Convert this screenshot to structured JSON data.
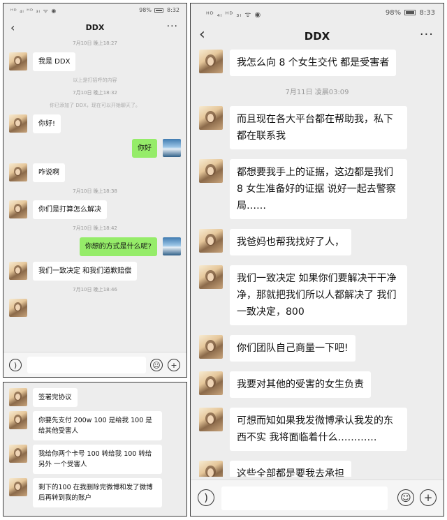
{
  "status": {
    "left": "ᴴᴰ ₄ₗ ᴴᴰ ₃ₗ ᯤ ◉",
    "battery_left": "98%",
    "time_left": "8:32",
    "battery_right": "98%",
    "time_right": "8:33"
  },
  "chat": {
    "title": "DDX",
    "back_icon": "‹",
    "more_icon": "···"
  },
  "panel_a": {
    "time_1": "7月10日 晚上18:27",
    "msg_1": "我是 DDX",
    "sys_1": "以上是打招呼的内容",
    "time_2": "7月10日 晚上18:32",
    "sys_2": "你已添加了 DDX，现在可以开始聊天了。",
    "msg_2": "你好!",
    "msg_me_1": "你好",
    "msg_3": "咋说啊",
    "time_3": "7月10日 晚上18:38",
    "msg_4": "你们是打算怎么解决",
    "time_4": "7月10日 晚上18:42",
    "msg_me_2": "你想的方式是什么呢?",
    "msg_5": "我们一致决定 和我们道歉赔偿",
    "time_5": "7月10日 晚上18:46"
  },
  "panel_b": {
    "msg_1": "签署完协议",
    "msg_2": "你要先支付 200w 100 是给我 100 是给其他受害人",
    "msg_3": "我给你两个卡号 100 转给我 100 转给另外 一个受害人",
    "msg_4": "剩下的100 在我删除完微博和发了微博后再转到我的账户"
  },
  "panel_c": {
    "msg_1": "我怎么向 8 个女生交代 都是受害者",
    "time_1": "7月11日 凌晨03:09",
    "msg_2": "而且现在各大平台都在帮助我，私下都在联系我",
    "msg_3": "都想要我手上的证据，这边都是我们 8 女生准备好的证据 说好一起去警察局……",
    "msg_4": "我爸妈也帮我找好了人，",
    "msg_5": "我们一致决定 如果你们要解决干干净净，那就把我们所以人都解决了 我们一致决定，800",
    "msg_6": "你们团队自己商量一下吧!",
    "msg_7": "我要对其他的受害的女生负责",
    "msg_8": "可想而知如果我发微博承认我发的东西不实 我将面临着什么…………",
    "msg_9": "这些全部都是要我去承担"
  },
  "icons": {
    "voice": "voice-icon",
    "emoji": "emoji-icon",
    "plus": "plus-icon"
  },
  "colors": {
    "my_bubble": "#95ec69",
    "their_bubble": "#ffffff",
    "chat_background": "#ededed"
  }
}
